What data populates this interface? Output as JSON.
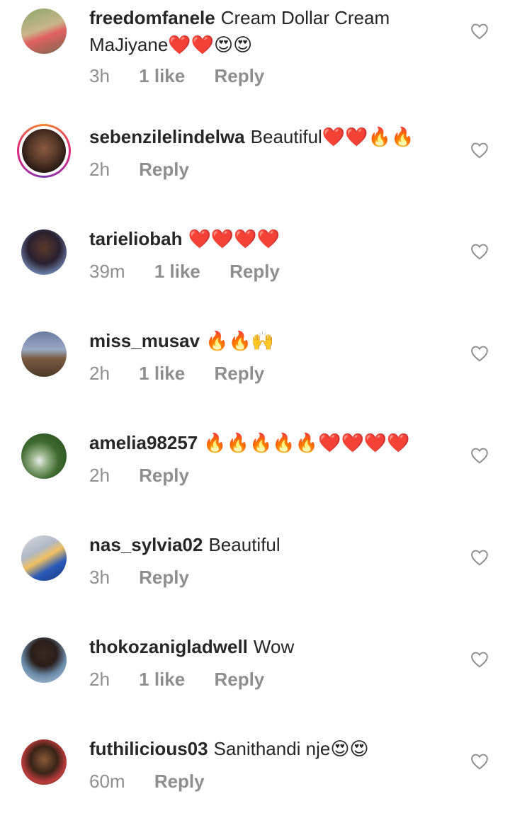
{
  "comments": [
    {
      "user": "freedomfanele",
      "text": "Cream Dollar Cream MaJiyane",
      "emoji": "❤️❤️😍😍",
      "time": "3h",
      "likes": "1 like",
      "reply": "Reply"
    },
    {
      "user": "sebenzilelindelwa",
      "text": "Beautiful",
      "emoji": "❤️❤️🔥🔥",
      "time": "2h",
      "likes": "",
      "reply": "Reply"
    },
    {
      "user": "tarieliobah",
      "text": "",
      "emoji": "❤️❤️❤️❤️",
      "time": "39m",
      "likes": "1 like",
      "reply": "Reply"
    },
    {
      "user": "miss_musav",
      "text": "",
      "emoji": "🔥🔥🙌",
      "time": "2h",
      "likes": "1 like",
      "reply": "Reply"
    },
    {
      "user": "amelia98257",
      "text": "",
      "emoji": "🔥🔥🔥🔥🔥❤️❤️❤️❤️",
      "time": "2h",
      "likes": "",
      "reply": "Reply"
    },
    {
      "user": "nas_sylvia02",
      "text": "Beautiful",
      "emoji": "",
      "time": "3h",
      "likes": "",
      "reply": "Reply"
    },
    {
      "user": "thokozanigladwell",
      "text": "Wow",
      "emoji": "",
      "time": "2h",
      "likes": "1 like",
      "reply": "Reply"
    },
    {
      "user": "futhilicious03",
      "text": "Sanithandi nje",
      "emoji": "😍😍",
      "time": "60m",
      "likes": "",
      "reply": "Reply"
    }
  ],
  "icons": {
    "like": "heart-outline-icon"
  },
  "colors": {
    "text": "#262626",
    "meta": "#8e8e8e",
    "story_ring": "#dd2a7b"
  }
}
